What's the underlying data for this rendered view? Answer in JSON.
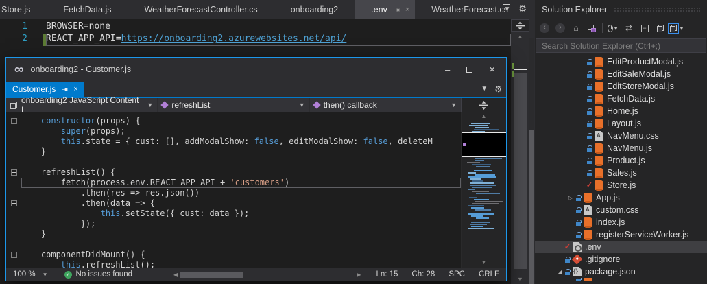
{
  "colors": {
    "accent": "#007acc",
    "window_border": "#1c97ea",
    "keyword": "#569cd6",
    "string": "#d69d85",
    "link": "#4ea1d3",
    "js_icon": "#e8702a",
    "check_mark": "#cf3e36",
    "lock": "#3f87c9",
    "selected_row": "#3f3f42"
  },
  "main_window": {
    "tabs": [
      {
        "label": "Store.js",
        "active": false
      },
      {
        "label": "FetchData.js",
        "active": false
      },
      {
        "label": "WeatherForecastController.cs",
        "active": false
      },
      {
        "label": "onboarding2",
        "active": false
      },
      {
        "label": ".env",
        "active": true
      },
      {
        "label": "WeatherForecast.cs",
        "active": false
      }
    ],
    "editor": {
      "line1_num": "1",
      "line1_text": "BROWSER=none",
      "line2_num": "2",
      "line2_prefix": "REACT_APP_API=",
      "line2_link": "https://onboarding2.azurewebsites.net/api/"
    }
  },
  "floating_window": {
    "title": "onboarding2 - Customer.js",
    "tab_label": "Customer.js",
    "navbar": {
      "scope": "onboarding2 JavaScript Content |",
      "member": "refreshList",
      "sub": "then() callback"
    },
    "code_lines": [
      {
        "partial": true,
        "segs": []
      },
      {
        "fold": true,
        "segs": [
          [
            "p",
            "    "
          ],
          [
            "k",
            "constructor"
          ],
          [
            "p",
            "(props) {"
          ]
        ]
      },
      {
        "segs": [
          [
            "p",
            "        "
          ],
          [
            "k",
            "super"
          ],
          [
            "p",
            "(props);"
          ]
        ]
      },
      {
        "segs": [
          [
            "p",
            "        "
          ],
          [
            "k",
            "this"
          ],
          [
            "p",
            ".state = { cust: [], addModalShow: "
          ],
          [
            "k",
            "false"
          ],
          [
            "p",
            ", editModalShow: "
          ],
          [
            "k",
            "false"
          ],
          [
            "p",
            ", deleteM"
          ]
        ]
      },
      {
        "segs": [
          [
            "p",
            "    }"
          ]
        ]
      },
      {
        "segs": []
      },
      {
        "fold": true,
        "segs": [
          [
            "p",
            "    refreshList() {"
          ]
        ]
      },
      {
        "cur": true,
        "segs": [
          [
            "p",
            "        fetch(process.env.RE"
          ],
          [
            "c",
            ""
          ],
          [
            "p",
            "ACT_APP_API + "
          ],
          [
            "s",
            "'customers'"
          ],
          [
            "p",
            ")"
          ]
        ]
      },
      {
        "segs": [
          [
            "p",
            "            .then(res => res.json())"
          ]
        ]
      },
      {
        "fold": true,
        "segs": [
          [
            "p",
            "            .then(data => {"
          ]
        ]
      },
      {
        "segs": [
          [
            "p",
            "                "
          ],
          [
            "k",
            "this"
          ],
          [
            "p",
            ".setState({ cust: data });"
          ]
        ]
      },
      {
        "segs": [
          [
            "p",
            "            });"
          ]
        ]
      },
      {
        "segs": [
          [
            "p",
            "    }"
          ]
        ]
      },
      {
        "segs": []
      },
      {
        "fold": true,
        "segs": [
          [
            "p",
            "    componentDidMount() {"
          ]
        ]
      },
      {
        "segs": [
          [
            "p",
            "        "
          ],
          [
            "k",
            "this"
          ],
          [
            "p",
            ".refreshList();"
          ]
        ]
      }
    ],
    "status": {
      "zoom": "100 %",
      "health": "No issues found",
      "line": "Ln: 15",
      "column": "Ch: 28",
      "spaces": "SPC",
      "eol": "CRLF"
    }
  },
  "solution_explorer": {
    "title": "Solution Explorer",
    "search_placeholder": "Search Solution Explorer (Ctrl+;)",
    "toolbar_icons": [
      "back",
      "forward",
      "home",
      "switch-views",
      "separator",
      "pending-changes-filter",
      "sync-with-active-document",
      "collapse-all",
      "show-all-files",
      "preview-selected-items"
    ],
    "items": [
      {
        "name": "EditProductModal.js",
        "icon": "js",
        "lock": true,
        "indent": 3
      },
      {
        "name": "EditSaleModal.js",
        "icon": "js",
        "lock": true,
        "indent": 3
      },
      {
        "name": "EditStoreModal.js",
        "icon": "js",
        "lock": true,
        "indent": 3
      },
      {
        "name": "FetchData.js",
        "icon": "js",
        "lock": true,
        "indent": 3
      },
      {
        "name": "Home.js",
        "icon": "js",
        "lock": true,
        "indent": 3
      },
      {
        "name": "Layout.js",
        "icon": "js",
        "lock": true,
        "indent": 3
      },
      {
        "name": "NavMenu.css",
        "icon": "css",
        "lock": true,
        "indent": 3
      },
      {
        "name": "NavMenu.js",
        "icon": "js",
        "lock": true,
        "indent": 3
      },
      {
        "name": "Product.js",
        "icon": "js",
        "lock": true,
        "indent": 3
      },
      {
        "name": "Sales.js",
        "icon": "js",
        "lock": true,
        "indent": 3
      },
      {
        "name": "Store.js",
        "icon": "js",
        "check": true,
        "indent": 3
      },
      {
        "name": "App.js",
        "icon": "js",
        "lock": true,
        "indent": 2,
        "expand": "collapsed"
      },
      {
        "name": "custom.css",
        "icon": "css",
        "lock": true,
        "indent": 2
      },
      {
        "name": "index.js",
        "icon": "js",
        "lock": true,
        "indent": 2
      },
      {
        "name": "registerServiceWorker.js",
        "icon": "js",
        "lock": true,
        "indent": 2
      },
      {
        "name": ".env",
        "icon": "env",
        "check": true,
        "indent": 1,
        "selected": true
      },
      {
        "name": ".gitignore",
        "icon": "git",
        "lock": true,
        "indent": 1
      },
      {
        "name": "package.json",
        "icon": "json",
        "lock": true,
        "indent": 1,
        "expand": "expanded"
      },
      {
        "name": "",
        "icon": "js",
        "lock": true,
        "indent": 2,
        "partial": true
      }
    ]
  }
}
